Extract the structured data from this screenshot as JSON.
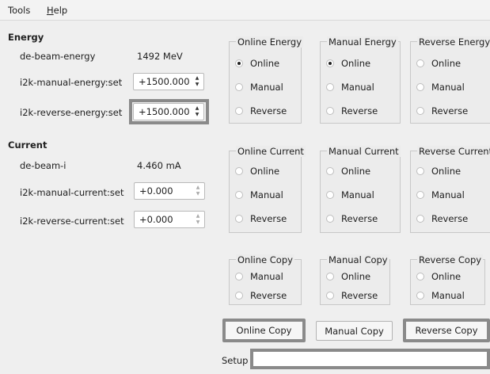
{
  "menu": {
    "tools": "Tools",
    "help": "Help"
  },
  "energy": {
    "title": "Energy",
    "beam_label": "de-beam-energy",
    "beam_value": "1492 MeV",
    "manual_label": "i2k-manual-energy:set",
    "manual_value": "+1500.000",
    "reverse_label": "i2k-reverse-energy:set",
    "reverse_value": "+1500.000"
  },
  "current": {
    "title": "Current",
    "beam_label": "de-beam-i",
    "beam_value": "4.460 mA",
    "manual_label": "i2k-manual-current:set",
    "manual_value": "+0.000",
    "reverse_label": "i2k-reverse-current:set",
    "reverse_value": "+0.000"
  },
  "groups": {
    "online_energy": {
      "title": "Online Energy",
      "options": [
        "Online",
        "Manual",
        "Reverse"
      ],
      "selected": "Online"
    },
    "manual_energy": {
      "title": "Manual Energy",
      "options": [
        "Online",
        "Manual",
        "Reverse"
      ],
      "selected": "Online"
    },
    "reverse_energy": {
      "title": "Reverse Energy",
      "options": [
        "Online",
        "Manual",
        "Reverse"
      ],
      "selected": ""
    },
    "online_current": {
      "title": "Online Current",
      "options": [
        "Online",
        "Manual",
        "Reverse"
      ],
      "selected": ""
    },
    "manual_current": {
      "title": "Manual Current",
      "options": [
        "Online",
        "Manual",
        "Reverse"
      ],
      "selected": ""
    },
    "reverse_current": {
      "title": "Reverse Current",
      "options": [
        "Online",
        "Manual",
        "Reverse"
      ],
      "selected": ""
    },
    "online_copy": {
      "title": "Online Copy",
      "options": [
        "Manual",
        "Reverse"
      ],
      "selected": ""
    },
    "manual_copy": {
      "title": "Manual Copy",
      "options": [
        "Online",
        "Reverse"
      ],
      "selected": ""
    },
    "reverse_copy": {
      "title": "Reverse Copy",
      "options": [
        "Online",
        "Manual"
      ],
      "selected": ""
    }
  },
  "buttons": {
    "online_copy": "Online Copy",
    "manual_copy": "Manual Copy",
    "reverse_copy": "Reverse Copy"
  },
  "setup": {
    "label": "Setup",
    "value": ""
  }
}
